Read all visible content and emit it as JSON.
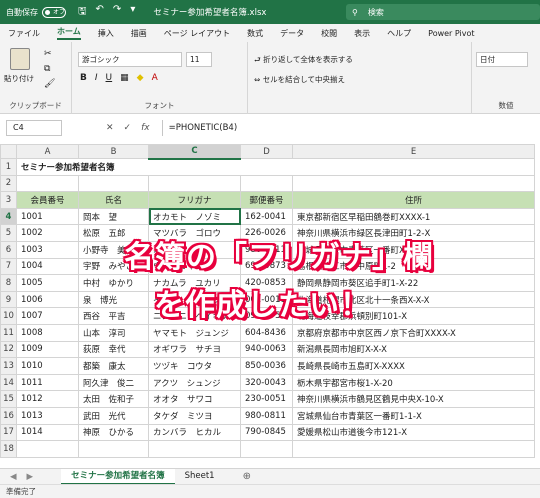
{
  "titlebar": {
    "autosave": "自動保存",
    "toggle": "オフ",
    "doc_title": "セミナー参加希望者名簿.xlsx",
    "search_placeholder": "検索"
  },
  "menu": [
    "ファイル",
    "ホーム",
    "挿入",
    "描画",
    "ページ レイアウト",
    "数式",
    "データ",
    "校閲",
    "表示",
    "ヘルプ",
    "Power Pivot"
  ],
  "ribbon": {
    "clipboard_label": "クリップボード",
    "paste_label": "貼り付け",
    "font_label": "フォント",
    "font_name": "游ゴシック",
    "font_size": "11",
    "wrap_text": "折り返して全体を表示する",
    "merge_center": "セルを結合して中央揃え",
    "number_format": "日付",
    "number_label": "数値"
  },
  "formula_bar": {
    "name_box": "C4",
    "formula": "=PHONETIC(B4)"
  },
  "grid": {
    "columns": [
      "A",
      "B",
      "C",
      "D",
      "E"
    ],
    "title": "セミナー参加希望者名簿",
    "headers": [
      "会員番号",
      "氏名",
      "フリガナ",
      "郵便番号",
      "住所"
    ],
    "rows": [
      [
        "1001",
        "岡本　望",
        "オカモト　ノゾミ",
        "162-0041",
        "東京都新宿区早稲田鶴巻町XXXX-1"
      ],
      [
        "1002",
        "松原　五郎",
        "マツバラ　ゴロウ",
        "226-0026",
        "神奈川県横浜市緑区長津田町1-2-X"
      ],
      [
        "1003",
        "小野寺　美紀",
        "オノデラ　ミキ",
        "980-0811",
        "宮城県仙台市青葉区一番町X-X-X"
      ],
      [
        "1004",
        "宇野　みやこ",
        "ウノ　ミヤコ",
        "690-0873",
        "島根県松江市内中原町1-2"
      ],
      [
        "1005",
        "中村　ゆかり",
        "ナカムラ　ユカリ",
        "420-0853",
        "静岡県静岡市葵区追手町1-X-22"
      ],
      [
        "1006",
        "泉　博光",
        "イズミ　ヒロミツ",
        "001-0011",
        "北海道札幌市北区北十一条西X-X-X"
      ],
      [
        "1007",
        "西谷　平吉",
        "ニシタニ　ヘイキチ",
        "098-6758",
        "北海道枝幸郡浜頓別町101-X"
      ],
      [
        "1008",
        "山本　淳司",
        "ヤマモト　ジュンジ",
        "604-8436",
        "京都府京都市中京区西ノ京下合町XXXX-X"
      ],
      [
        "1009",
        "荻原　幸代",
        "オギワラ　サチヨ",
        "940-0063",
        "新潟県長岡市旭町X-X-X"
      ],
      [
        "1010",
        "都築　康太",
        "ツヅキ　コウタ",
        "850-0036",
        "長崎県長崎市五島町X-XXXX"
      ],
      [
        "1011",
        "阿久津　俊二",
        "アクツ　シュンジ",
        "320-0043",
        "栃木県宇都宮市桜1-X-20"
      ],
      [
        "1012",
        "太田　佐和子",
        "オオタ　サワコ",
        "230-0051",
        "神奈川県横浜市鶴見区鶴見中央X-10-X"
      ],
      [
        "1013",
        "武田　光代",
        "タケダ　ミツヨ",
        "980-0811",
        "宮城県仙台市青葉区一番町1-1-X"
      ],
      [
        "1014",
        "神原　ひかる",
        "カンバラ　ヒカル",
        "790-0845",
        "愛媛県松山市道後今市121-X"
      ]
    ]
  },
  "sheet_tabs": [
    "セミナー参加希望者名簿",
    "Sheet1"
  ],
  "status": "準備完了",
  "overlay": {
    "line1": "名簿の「フリガナ」欄",
    "line2": "を作成したい！"
  }
}
